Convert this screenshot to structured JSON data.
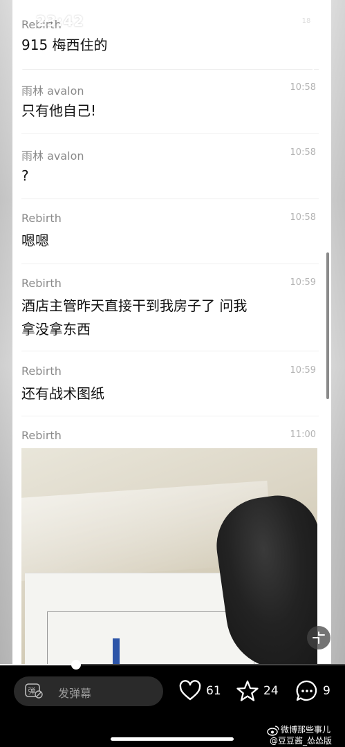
{
  "status_bar": {
    "time": "23:42",
    "battery": "18"
  },
  "messages": [
    {
      "sender": "Rebirth",
      "time": "",
      "text": "915 梅西住的"
    },
    {
      "sender": "雨林 avalon",
      "time": "10:58",
      "text": "只有他自己!"
    },
    {
      "sender": "雨林 avalon",
      "time": "10:58",
      "text": "?"
    },
    {
      "sender": "Rebirth",
      "time": "10:58",
      "text": "嗯嗯"
    },
    {
      "sender": "Rebirth",
      "time": "10:59",
      "text": "酒店主管昨天直接干到我房子了  问我拿没拿东西"
    },
    {
      "sender": "Rebirth",
      "time": "10:59",
      "text": "还有战术图纸"
    },
    {
      "sender": "Rebirth",
      "time": "11:00",
      "text": ""
    }
  ],
  "bottom_bar": {
    "danmu_placeholder": "发弹幕",
    "like_count": "61",
    "favorite_count": "24",
    "comment_count": "9",
    "progress": 0.22
  },
  "watermark": {
    "line1": "微博那些事儿",
    "line2": "@豆豆酱_怂怂版"
  },
  "colors": {
    "accent_white": "#ffffff",
    "panel_bg": "#ffffff",
    "bar_bg": "#000000"
  }
}
